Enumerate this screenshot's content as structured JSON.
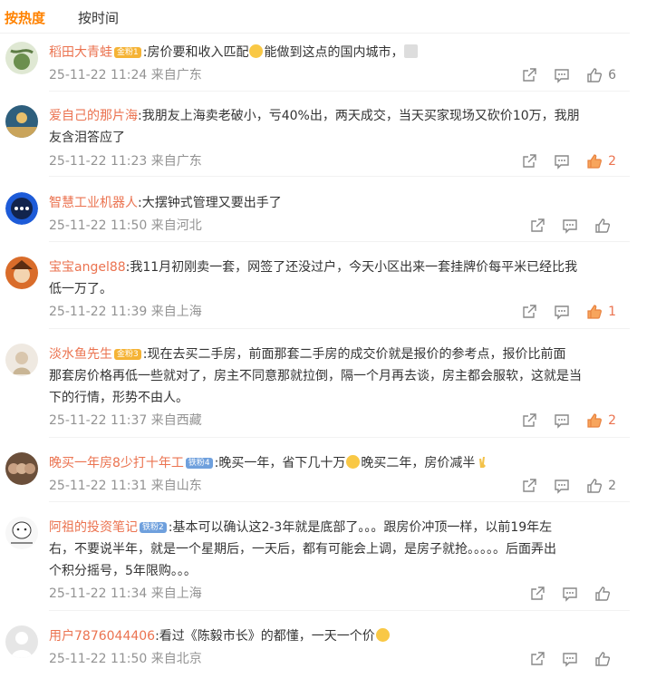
{
  "tabs": {
    "hot": "按热度",
    "time": "按时间"
  },
  "colors": {
    "accent": "#ff8200",
    "username": "#eb7350",
    "meta": "#939393",
    "liked": "#eb7350"
  },
  "comments": [
    {
      "user": "稻田大青蛙",
      "badge": "金粉1",
      "badge_type": "gold",
      "text_pre": ":房价要和收入匹配",
      "text_mid": "能做到这点的国内城市，",
      "text_post": "",
      "lines": [],
      "time": "25-11-22 11:24",
      "location": "来自广东",
      "likes": "6",
      "liked": false,
      "emojis": [
        "smile-emoji",
        "mute-emoji"
      ]
    },
    {
      "user": "爱自己的那片海",
      "badge": "",
      "badge_type": "",
      "lines": [
        ":我朋友上海卖老破小，亏40%出，两天成交，当天买家现场又砍价10万，我朋",
        "友含泪答应了"
      ],
      "time": "25-11-22 11:23",
      "location": "来自广东",
      "likes": "2",
      "liked": true
    },
    {
      "user": "智慧工业机器人",
      "badge": "",
      "badge_type": "",
      "lines": [
        ":大摆钟式管理又要出手了"
      ],
      "time": "25-11-22 11:50",
      "location": "来自河北",
      "likes": "",
      "liked": false
    },
    {
      "user": "宝宝angel88",
      "badge": "",
      "badge_type": "",
      "lines": [
        ":我11月初刚卖一套，网签了还没过户，今天小区出来一套挂牌价每平米已经比我",
        "低一万了。"
      ],
      "time": "25-11-22 11:39",
      "location": "来自上海",
      "likes": "1",
      "liked": true
    },
    {
      "user": "淡水鱼先生",
      "badge": "金粉3",
      "badge_type": "gold",
      "lines": [
        ":现在去买二手房，前面那套二手房的成交价就是报价的参考点，报价比前面",
        "那套房价格再低一些就对了，房主不同意那就拉倒，隔一个月再去谈，房主都会服软，这就是当",
        "下的行情，形势不由人。"
      ],
      "time": "25-11-22 11:37",
      "location": "来自西藏",
      "likes": "2",
      "liked": true
    },
    {
      "user": "晚买一年房8少打十年工",
      "badge": "铁粉4",
      "badge_type": "blue",
      "text_pre": ":晚买一年，省下几十万",
      "text_mid": "晚买二年，房价减半",
      "text_post": "",
      "lines": [],
      "time": "25-11-22 11:31",
      "location": "来自山东",
      "likes": "2",
      "liked": false,
      "emojis": [
        "grin-emoji",
        "peace-emoji"
      ]
    },
    {
      "user": "阿祖的投资笔记",
      "badge": "铁粉2",
      "badge_type": "blue",
      "lines": [
        ":基本可以确认这2-3年就是底部了。。。跟房价冲顶一样，以前19年左",
        "右，不要说半年，就是一个星期后，一天后，都有可能会上调，是房子就抢。。。。。后面弄出",
        "个积分摇号，5年限购。。。"
      ],
      "time": "25-11-22 11:34",
      "location": "来自上海",
      "likes": "",
      "liked": false
    },
    {
      "user": "用户7876044406",
      "badge": "",
      "badge_type": "",
      "text_pre": ":看过《陈毅市长》的都懂，一天一个价",
      "text_mid": "",
      "text_post": "",
      "lines": [],
      "time": "25-11-22 11:50",
      "location": "来自北京",
      "likes": "",
      "liked": false,
      "emojis": [
        "sad-emoji"
      ]
    }
  ]
}
